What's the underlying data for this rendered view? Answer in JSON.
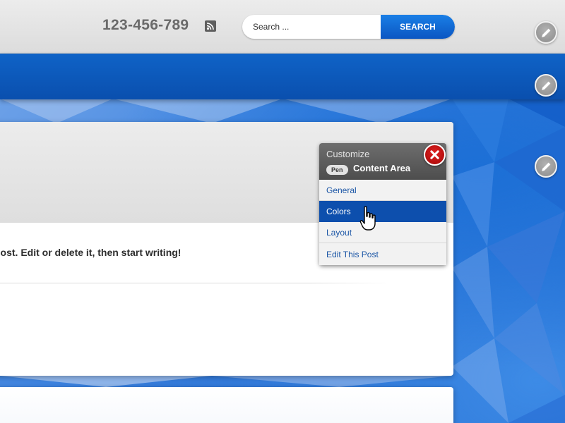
{
  "header": {
    "phone": "123-456-789",
    "search": {
      "placeholder": "Search ...",
      "button_label": "SEARCH"
    }
  },
  "content": {
    "intro_text": "post. Edit or delete it, then start writing!"
  },
  "customize_panel": {
    "title": "Customize",
    "badge": "Pen",
    "subtitle": "Content Area",
    "items": [
      {
        "label": "General",
        "active": false
      },
      {
        "label": "Colors",
        "active": true
      },
      {
        "label": "Layout",
        "active": false
      },
      {
        "label": "Edit This Post",
        "active": false
      }
    ]
  },
  "icons": {
    "edit": "pencil-icon",
    "rss": "rss-icon",
    "close": "close-icon",
    "cursor": "hand-pointer-icon"
  },
  "colors": {
    "accent_blue": "#0d4fad",
    "search_button": "#0b56c2",
    "close_red": "#c20e0e",
    "phone_gray": "#6a6a6a"
  }
}
